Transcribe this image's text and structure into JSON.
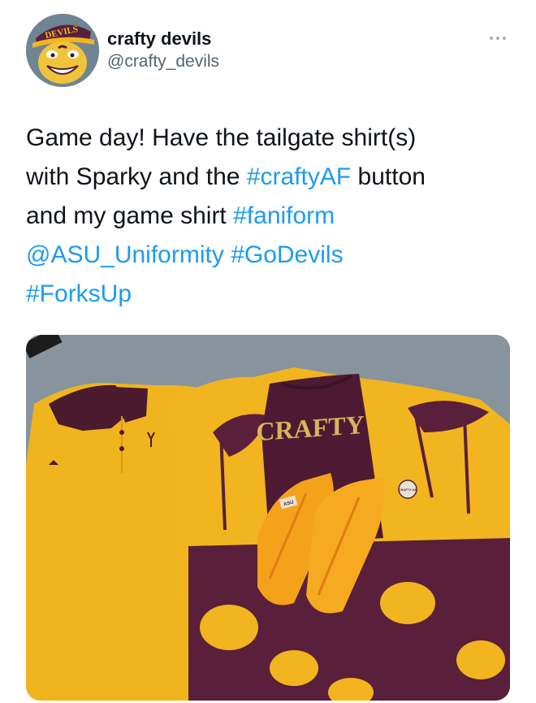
{
  "author": {
    "display_name": "crafty devils",
    "handle": "@crafty_devils",
    "avatar_icon": "devil-mascot-avatar",
    "avatar_hat_text": "DEVILS"
  },
  "tweet": {
    "line1": "Game day! Have the tailgate shirt(s)",
    "line2_prefix": "with Sparky and the ",
    "line2_hashtag": "#craftyAF",
    "line2_suffix": " button",
    "line3_prefix": "and my game shirt ",
    "line3_hashtag": "#faniform",
    "line4_mention": "@ASU_Uniformity",
    "line4_space": " ",
    "line4_hashtag": "#GoDevils",
    "line5_hashtag": "#ForksUp"
  },
  "media": {
    "shirt_text": "CRAFTY",
    "shoe_tag": "ASU",
    "button_text": "CRAFTY AF"
  },
  "colors": {
    "link": "#1d9bf0",
    "text": "#0f1419",
    "secondary": "#536471",
    "gold": "#f2b51f",
    "maroon": "#5a1f3a"
  },
  "icons": {
    "more": "more-options-icon"
  }
}
